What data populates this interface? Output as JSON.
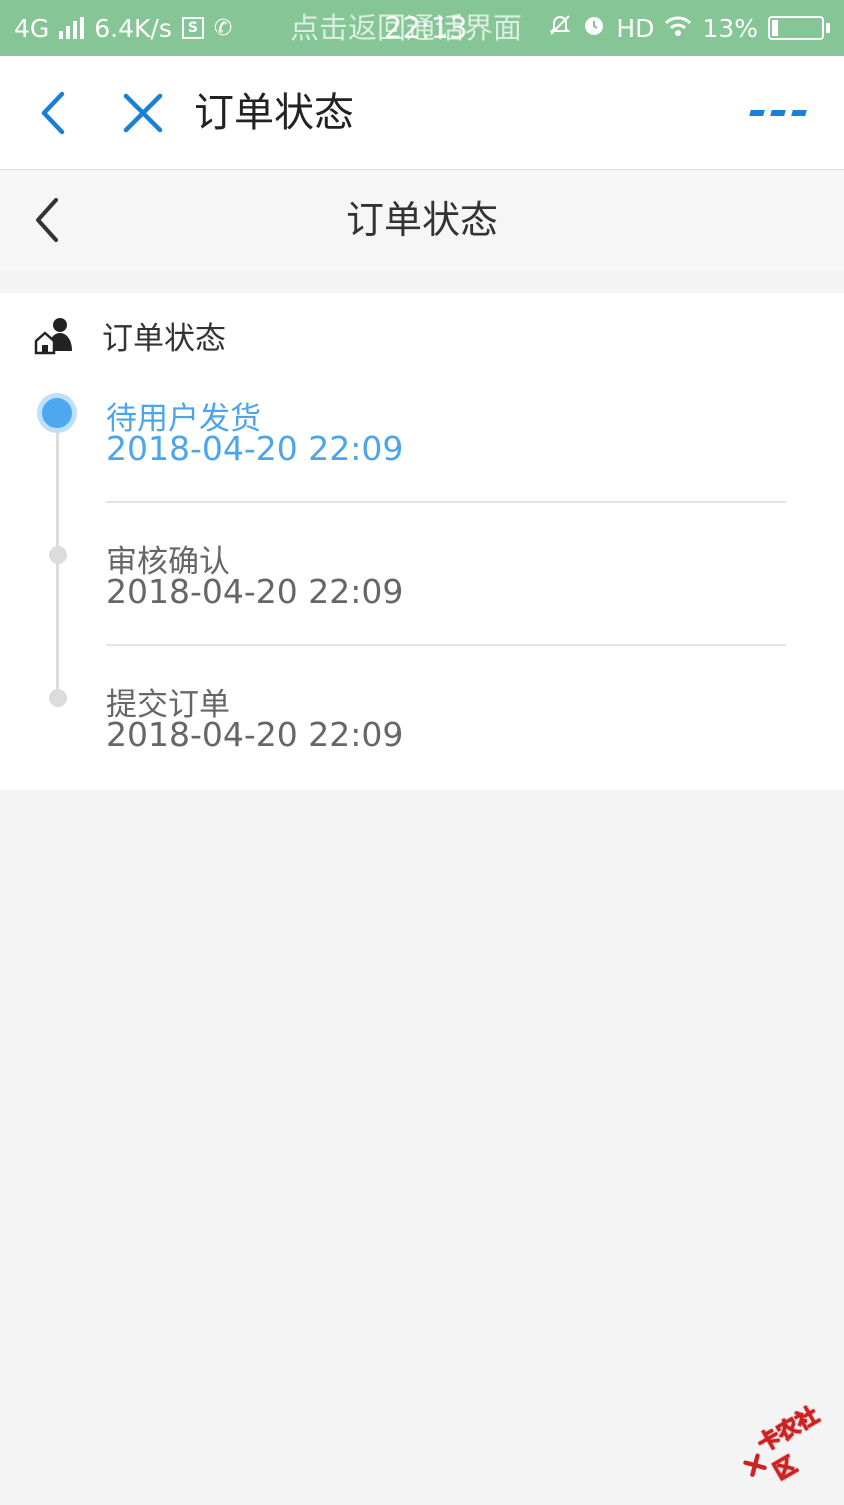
{
  "status_bar": {
    "network": "4G",
    "speed": "6.4K/s",
    "call_banner": "点击返回通话界面",
    "time": "22:13",
    "hd": "HD",
    "battery_percent": "13%",
    "battery_level": 0.13
  },
  "app_header": {
    "title": "订单状态",
    "back_icon": "chevron-left-icon",
    "close_icon": "close-icon",
    "more_icon": "more-icon"
  },
  "page_header": {
    "title": "订单状态"
  },
  "order_status": {
    "section_title": "订单状态",
    "steps": [
      {
        "name": "待用户发货",
        "time": "2018-04-20 22:09",
        "active": true
      },
      {
        "name": "审核确认",
        "time": "2018-04-20 22:09",
        "active": false
      },
      {
        "name": "提交订单",
        "time": "2018-04-20 22:09",
        "active": false
      }
    ]
  },
  "watermark": {
    "text": "卡农社区"
  },
  "colors": {
    "status_bar": "#86c596",
    "accent_blue": "#1a7fd6",
    "active_step": "#4ca5ea",
    "background": "#f4f4f4"
  }
}
